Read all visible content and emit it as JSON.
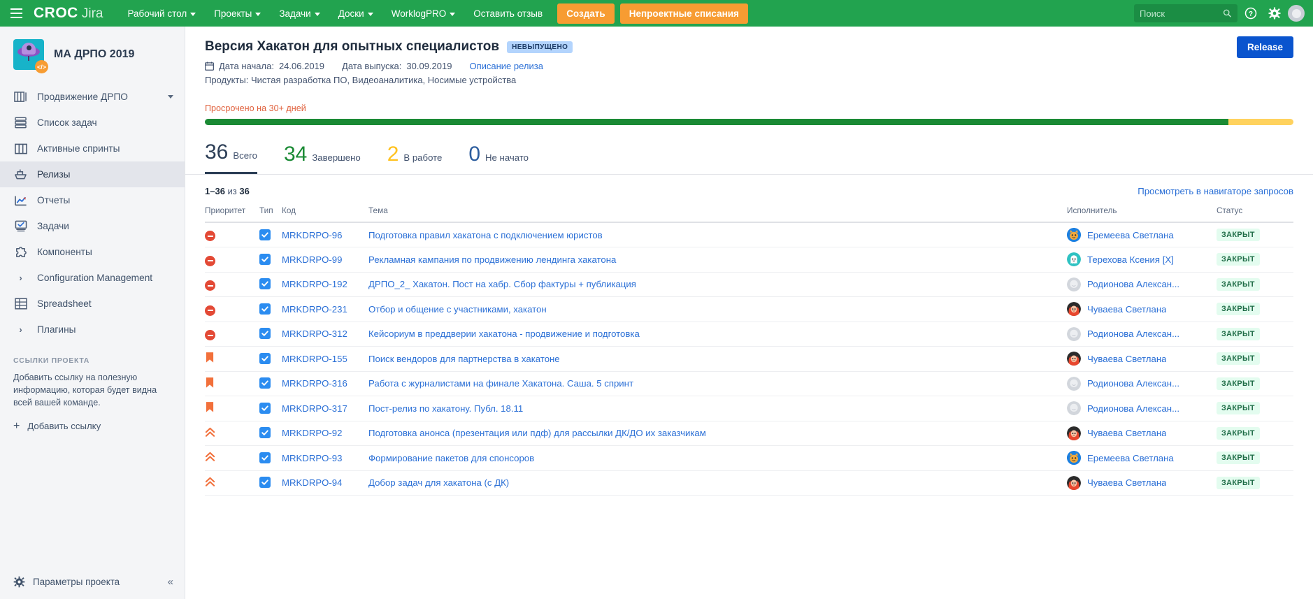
{
  "topnav": {
    "brand_primary": "CROC",
    "brand_secondary": "Jira",
    "menu": [
      {
        "label": "Рабочий стол",
        "caret": true
      },
      {
        "label": "Проекты",
        "caret": true
      },
      {
        "label": "Задачи",
        "caret": true
      },
      {
        "label": "Доски",
        "caret": true
      },
      {
        "label": "WorklogPRO",
        "caret": true
      },
      {
        "label": "Оставить отзыв",
        "caret": false
      }
    ],
    "create_button": "Создать",
    "nonproject_button": "Непроектные списания",
    "search_placeholder": "Поиск",
    "search_value": "",
    "help_icon": "help-icon",
    "settings_icon": "gear-icon",
    "avatar_icon": "user-avatar-icon",
    "brand_green": "#22a34f",
    "orange": "#f79c32"
  },
  "sidebar": {
    "project_name": "МА ДРПО 2019",
    "items": [
      {
        "label": "Продвижение ДРПО",
        "icon": "board-icon",
        "caret": true,
        "active": false
      },
      {
        "label": "Список задач",
        "icon": "backlog-icon",
        "caret": false,
        "active": false
      },
      {
        "label": "Активные спринты",
        "icon": "columns-icon",
        "caret": false,
        "active": false
      },
      {
        "label": "Релизы",
        "icon": "ship-icon",
        "caret": false,
        "active": true
      },
      {
        "label": "Отчеты",
        "icon": "chart-icon",
        "caret": false,
        "active": false
      },
      {
        "label": "Задачи",
        "icon": "issues-icon",
        "caret": false,
        "active": false
      },
      {
        "label": "Компоненты",
        "icon": "puzzle-icon",
        "caret": false,
        "active": false
      },
      {
        "label": "Configuration Management",
        "icon": "chevron-right-icon",
        "caret": false,
        "active": false
      },
      {
        "label": "Spreadsheet",
        "icon": "table-icon",
        "caret": false,
        "active": false
      },
      {
        "label": "Плагины",
        "icon": "chevron-right-icon",
        "caret": false,
        "active": false
      }
    ],
    "links_title": "ССЫЛКИ ПРОЕКТА",
    "links_desc": "Добавить ссылку на полезную информацию, которая будет видна всей вашей команде.",
    "add_link": "Добавить ссылку",
    "add_link_icon": "plus-icon",
    "settings_label": "Параметры проекта",
    "settings_icon": "gear-icon",
    "collapse_icon": "double-chevron-left-icon"
  },
  "header": {
    "title": "Версия Хакатон для опытных специалистов",
    "status_badge": "НЕВЫПУЩЕНО",
    "release_button": "Release",
    "calendar_icon": "calendar-icon",
    "start_date_label": "Дата начала:",
    "start_date": "24.06.2019",
    "release_date_label": "Дата выпуска:",
    "release_date": "30.09.2019",
    "description_link": "Описание релиза",
    "products_label": "Продукты:",
    "products": "Чистая разработка ПО, Видеоаналитика, Носимые устройства"
  },
  "progress": {
    "overdue_text": "Просрочено на 30+ дней",
    "green_percent": 94,
    "yellow_percent": 6,
    "green_color": "#1a8a34",
    "yellow_color": "#ffd25e",
    "overdue_color": "#e0603c"
  },
  "stats": [
    {
      "num": "36",
      "label": "Всего",
      "color": "#2c3e56",
      "selected": true
    },
    {
      "num": "34",
      "label": "Завершено",
      "color": "#1a8a34",
      "selected": false
    },
    {
      "num": "2",
      "label": "В работе",
      "color": "#ffc21f",
      "selected": false
    },
    {
      "num": "0",
      "label": "Не начато",
      "color": "#2c5d9e",
      "selected": false
    }
  ],
  "list": {
    "count_prefix": "1–36",
    "count_middle": "из",
    "count_total": "36",
    "navigator_link": "Просмотреть в навигаторе запросов",
    "columns": [
      "Приоритет",
      "Тип",
      "Код",
      "Тема",
      "Исполнитель",
      "Статус"
    ],
    "rows": [
      {
        "priority": "blocker",
        "type": "task",
        "code": "MRKDRPO-96",
        "topic": "Подготовка правил хакатона с подключением юристов",
        "assignee": "Еремеева Светлана",
        "avatar": "cat-avatar",
        "status": "ЗАКРЫТ"
      },
      {
        "priority": "blocker",
        "type": "task",
        "code": "MRKDRPO-99",
        "topic": "Рекламная кампания по продвижению лендинга хакатона",
        "assignee": "Терехова Ксения [X]",
        "avatar": "ghost-avatar",
        "status": "ЗАКРЫТ"
      },
      {
        "priority": "blocker",
        "type": "task",
        "code": "MRKDRPO-192",
        "topic": "ДРПО_2_ Хакатон. Пост на хабр. Сбор фактуры + публикация",
        "assignee": "Родионова Алексан...",
        "avatar": "blank-avatar",
        "status": "ЗАКРЫТ"
      },
      {
        "priority": "blocker",
        "type": "task",
        "code": "MRKDRPO-231",
        "topic": "Отбор и общение с участниками, хакатон",
        "assignee": "Чуваева Светлана",
        "avatar": "woman-avatar",
        "status": "ЗАКРЫТ"
      },
      {
        "priority": "blocker",
        "type": "task",
        "code": "MRKDRPO-312",
        "topic": "Кейсориум в преддверии хакатона - продвижение и подготовка",
        "assignee": "Родионова Алексан...",
        "avatar": "blank-avatar",
        "status": "ЗАКРЫТ"
      },
      {
        "priority": "critical",
        "type": "task",
        "code": "MRKDRPO-155",
        "topic": "Поиск вендоров для партнерства в хакатоне",
        "assignee": "Чуваева Светлана",
        "avatar": "woman-avatar",
        "status": "ЗАКРЫТ"
      },
      {
        "priority": "critical",
        "type": "task",
        "code": "MRKDRPO-316",
        "topic": "Работа с журналистами на финале Хакатона. Саша. 5 спринт",
        "assignee": "Родионова Алексан...",
        "avatar": "blank-avatar",
        "status": "ЗАКРЫТ"
      },
      {
        "priority": "critical",
        "type": "task",
        "code": "MRKDRPO-317",
        "topic": "Пост-релиз по хакатону. Публ. 18.11",
        "assignee": "Родионова Алексан...",
        "avatar": "blank-avatar",
        "status": "ЗАКРЫТ"
      },
      {
        "priority": "major",
        "type": "task",
        "code": "MRKDRPO-92",
        "topic": "Подготовка анонса (презентация или пдф) для рассылки ДК/ДО их заказчикам",
        "assignee": "Чуваева Светлана",
        "avatar": "woman-avatar",
        "status": "ЗАКРЫТ"
      },
      {
        "priority": "major",
        "type": "task",
        "code": "MRKDRPO-93",
        "topic": "Формирование пакетов для спонсоров",
        "assignee": "Еремеева Светлана",
        "avatar": "cat-avatar",
        "status": "ЗАКРЫТ"
      },
      {
        "priority": "major",
        "type": "task",
        "code": "MRKDRPO-94",
        "topic": "Добор задач для хакатона (с ДК)",
        "assignee": "Чуваева Светлана",
        "avatar": "woman-avatar",
        "status": "ЗАКРЫТ"
      }
    ]
  }
}
